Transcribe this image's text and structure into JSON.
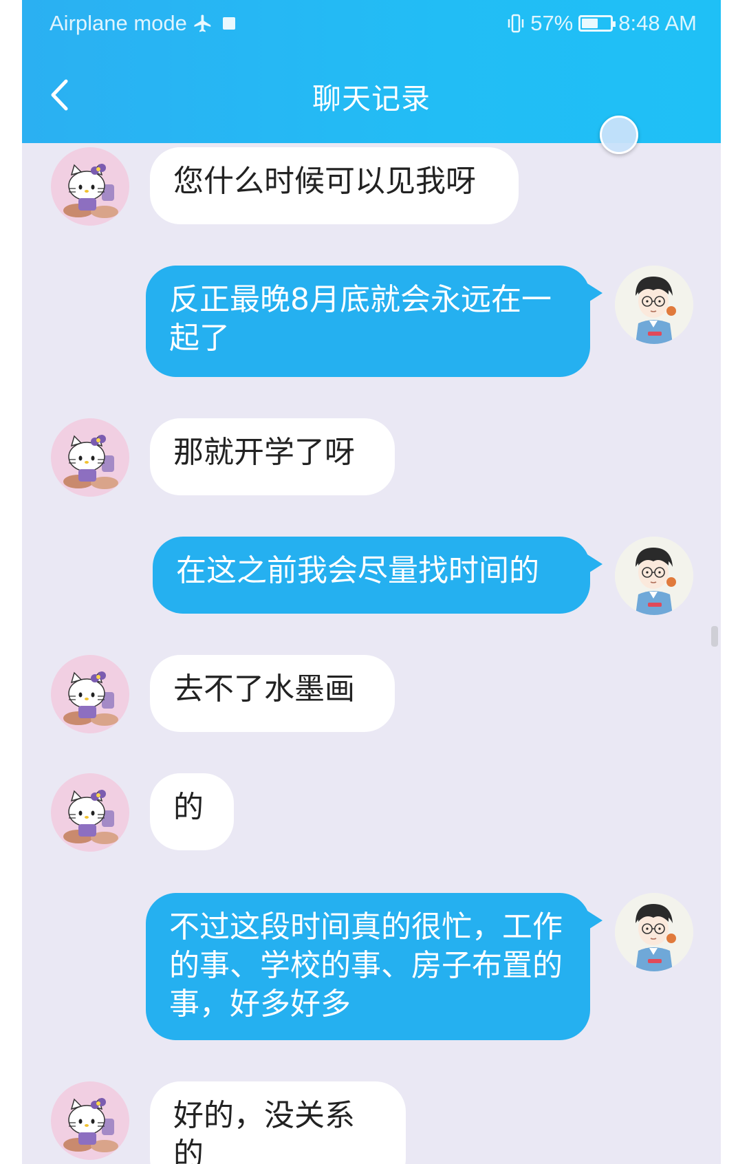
{
  "status_bar": {
    "left_text": "Airplane mode",
    "battery": "57%",
    "battery_level": 0.57,
    "time": "8:48 AM"
  },
  "header": {
    "title": "聊天记录"
  },
  "icons": {
    "back": "chevron-left-icon",
    "airplane": "airplane-icon",
    "battery": "battery-icon",
    "vibrate": "vibrate-icon"
  },
  "colors": {
    "header": "#25b4f3",
    "outgoing_bubble": "#25b0f0",
    "incoming_bubble": "#ffffff",
    "background": "#eae8f4"
  },
  "messages": [
    {
      "side": "in",
      "text": "您什么时候可以见我呀"
    },
    {
      "side": "out",
      "text": "反正最晚8月底就会永远在一起了"
    },
    {
      "side": "in",
      "text": "那就开学了呀"
    },
    {
      "side": "out",
      "text": "在这之前我会尽量找时间的"
    },
    {
      "side": "in",
      "text": "去不了水墨画"
    },
    {
      "side": "in",
      "text": "的"
    },
    {
      "side": "out",
      "text": "不过这段时间真的很忙，工作的事、学校的事、房子布置的事，好多好多"
    },
    {
      "side": "in",
      "text": "好的，没关系的"
    }
  ]
}
